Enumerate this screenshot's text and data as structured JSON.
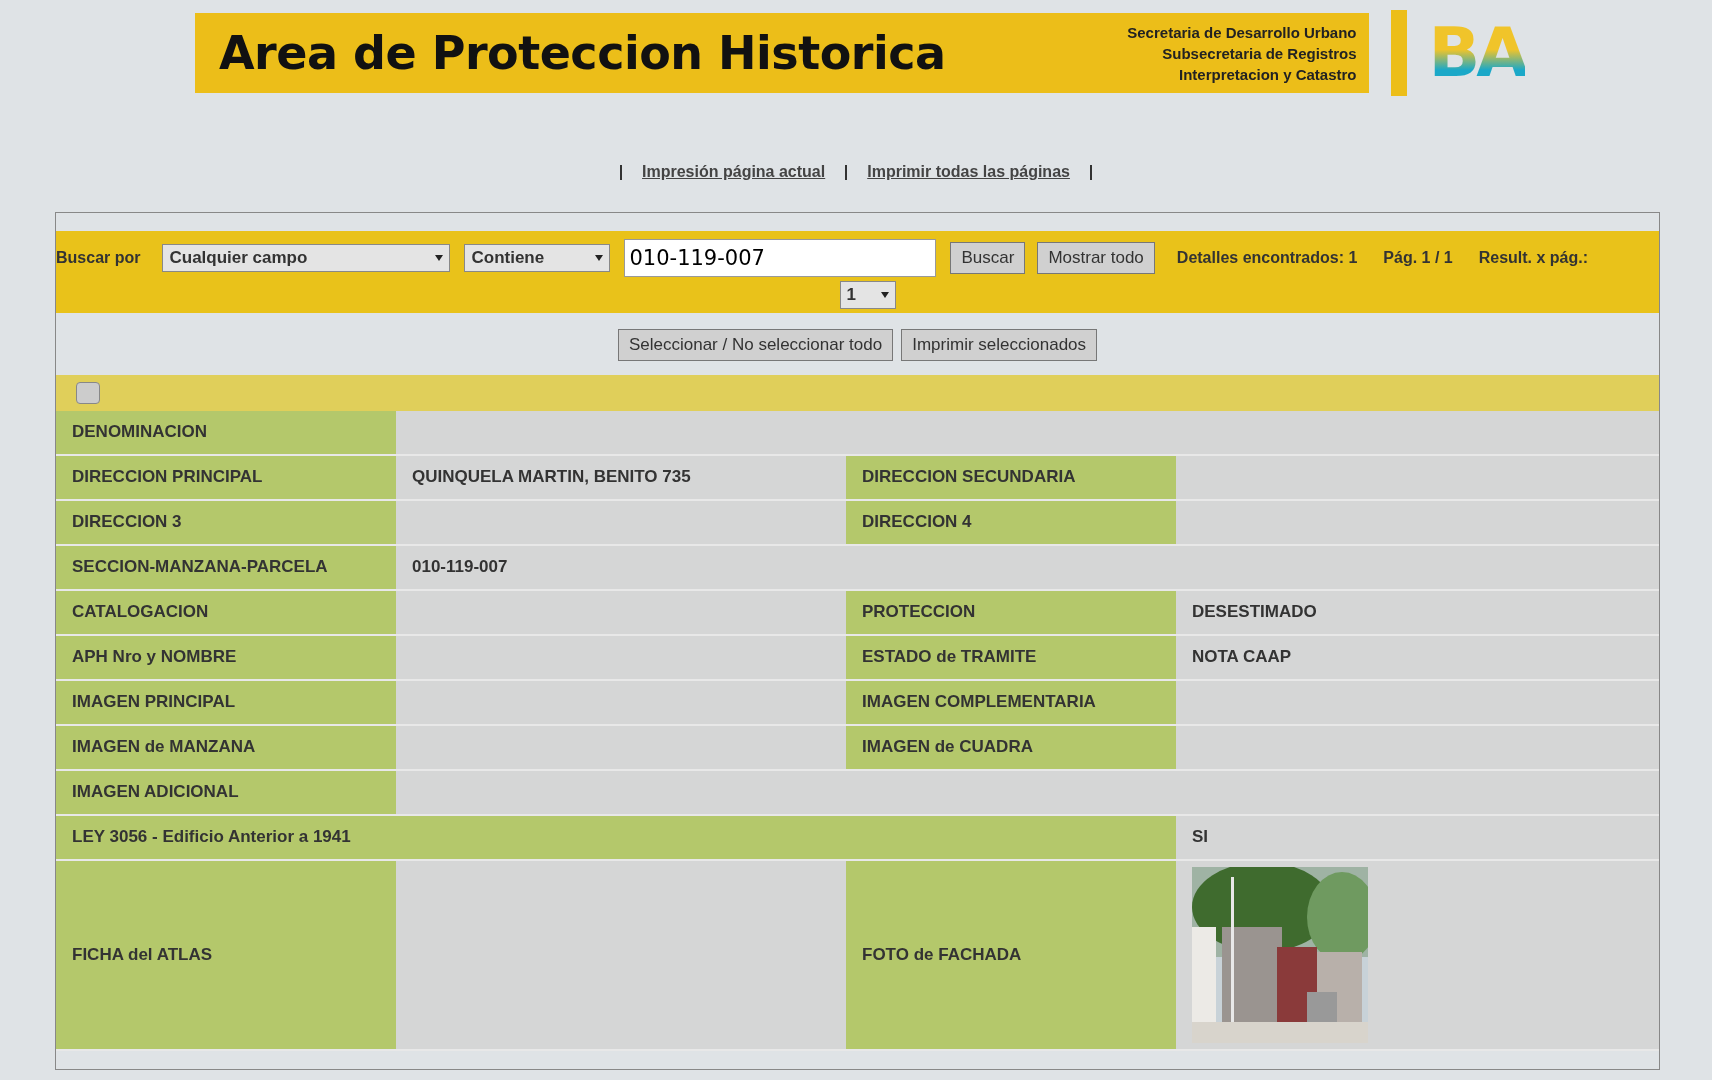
{
  "header": {
    "title": "Area de Proteccion Historica",
    "org_lines": [
      "Secretaria de Desarrollo Urbano",
      "Subsecretaria de Registros",
      "Interpretacion y Catastro"
    ],
    "logo": "BA"
  },
  "print_links": [
    "Impresión página actual",
    "Imprimir todas las páginas"
  ],
  "search": {
    "label": "Buscar por",
    "field_select": "Cualquier campo",
    "operator_select": "Contiene",
    "value": "010-119-007",
    "buttons": [
      "Buscar",
      "Mostrar todo"
    ],
    "found": "Detalles encontrados: 1",
    "page": "Pág. 1 / 1",
    "per_page_label": "Result. x pág.:",
    "per_page": "1"
  },
  "selection_buttons": [
    "Seleccionar / No seleccionar todo",
    "Imprimir seleccionados"
  ],
  "select_all": {
    "checked": false
  },
  "rows": [
    {
      "cells": [
        {
          "kind": "label",
          "text": "DENOMINACION"
        },
        {
          "kind": "value"
        }
      ]
    },
    {
      "cells": [
        {
          "kind": "label",
          "text": "DIRECCION PRINCIPAL"
        },
        {
          "kind": "value",
          "text": "QUINQUELA MARTIN, BENITO 735"
        },
        {
          "kind": "label",
          "text": "DIRECCION SECUNDARIA"
        },
        {
          "kind": "value"
        }
      ]
    },
    {
      "cells": [
        {
          "kind": "label",
          "text": "DIRECCION 3"
        },
        {
          "kind": "value"
        },
        {
          "kind": "label",
          "text": "DIRECCION 4"
        },
        {
          "kind": "value"
        }
      ]
    },
    {
      "cells": [
        {
          "kind": "label",
          "text": "SECCION-MANZANA-PARCELA"
        },
        {
          "kind": "value",
          "text": "010-119-007"
        },
        {
          "kind": "value"
        }
      ]
    },
    {
      "cells": [
        {
          "kind": "label",
          "text": "CATALOGACION"
        },
        {
          "kind": "value"
        },
        {
          "kind": "label",
          "text": "PROTECCION"
        },
        {
          "kind": "value",
          "text": "DESESTIMADO"
        }
      ]
    },
    {
      "cells": [
        {
          "kind": "label",
          "text": "APH Nro y NOMBRE"
        },
        {
          "kind": "value"
        },
        {
          "kind": "label",
          "text": "ESTADO de TRAMITE"
        },
        {
          "kind": "value",
          "text": "NOTA CAAP"
        }
      ]
    },
    {
      "cells": [
        {
          "kind": "label",
          "text": "IMAGEN PRINCIPAL"
        },
        {
          "kind": "value"
        },
        {
          "kind": "label",
          "text": "IMAGEN COMPLEMENTARIA"
        },
        {
          "kind": "value"
        }
      ]
    },
    {
      "cells": [
        {
          "kind": "label",
          "text": "IMAGEN de MANZANA"
        },
        {
          "kind": "value"
        },
        {
          "kind": "label",
          "text": "IMAGEN de CUADRA"
        },
        {
          "kind": "value"
        }
      ]
    },
    {
      "cells": [
        {
          "kind": "label",
          "text": "IMAGEN ADICIONAL"
        },
        {
          "kind": "value"
        }
      ]
    },
    {
      "cells": [
        {
          "kind": "wide_label",
          "text": "LEY 3056 - Edificio Anterior a 1941"
        },
        {
          "kind": "value",
          "text": "SI"
        }
      ]
    },
    {
      "cells": [
        {
          "kind": "label",
          "text": "FICHA del ATLAS"
        },
        {
          "kind": "value"
        },
        {
          "kind": "label",
          "text": "FOTO de FACHADA"
        },
        {
          "kind": "picture"
        }
      ]
    }
  ]
}
